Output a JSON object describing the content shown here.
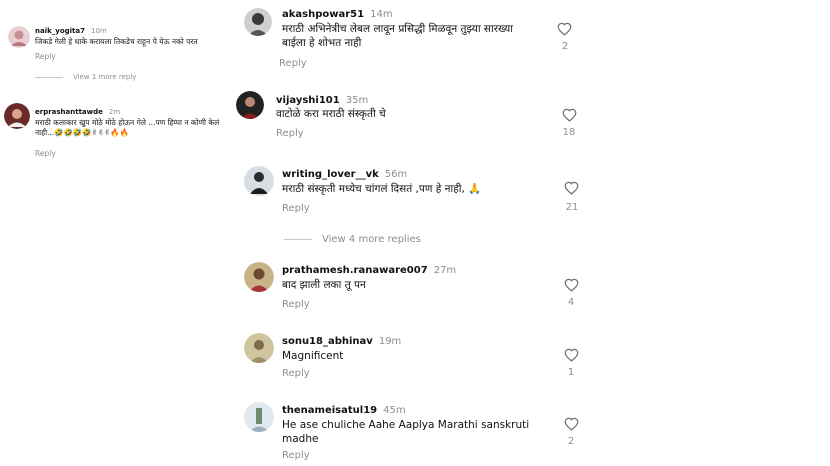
{
  "left_comments": [
    {
      "username": "naik_yogita7",
      "time": "10m",
      "text": "जिकडे गेली हे धाके करायला तिकडेच राहून पे येऊ नको परत",
      "reply": "Reply"
    },
    {
      "username": "erprashanttawde",
      "time": "2m",
      "text": "मराठी कलाकार खुप मोठे मोठे होऊन गेले ...पण हिप्पा न कोणी केलं नाही...🤣🤣🤣🤣✌✌✌🔥🔥",
      "reply": "Reply"
    }
  ],
  "left_view_more": "View 1 more reply",
  "main_comments": [
    {
      "username": "akashpowar51",
      "time": "14m",
      "text": "मराठी अभिनेत्रीच लेबल लावून प्रसिद्धी मिळवून तुझ्या सारख्या बाईला हे शोभत नाही",
      "reply": "Reply",
      "likes": "2"
    },
    {
      "username": "vijayshi101",
      "time": "35m",
      "text": "वाटोळे करा मराठी संस्कृती चे",
      "reply": "Reply",
      "likes": "18"
    },
    {
      "username": "writing_lover__vk",
      "time": "56m",
      "text": "मराठी संस्कृती मध्येच चांगलं दिसतं ,पण हे नाही, 🙏",
      "reply": "Reply",
      "likes": "21"
    },
    {
      "username": "prathamesh.ranaware007",
      "time": "27m",
      "text": "बाद झाली लका तू पन",
      "reply": "Reply",
      "likes": "4"
    },
    {
      "username": "sonu18_abhinav",
      "time": "19m",
      "text": "Magnificent",
      "reply": "Reply",
      "likes": "1"
    },
    {
      "username": "thenameisatul19",
      "time": "45m",
      "text": "He ase chuliche Aahe Aaplya Marathi sanskruti madhe",
      "reply": "Reply",
      "likes": "2"
    }
  ],
  "main_view_more": "View 4 more replies"
}
